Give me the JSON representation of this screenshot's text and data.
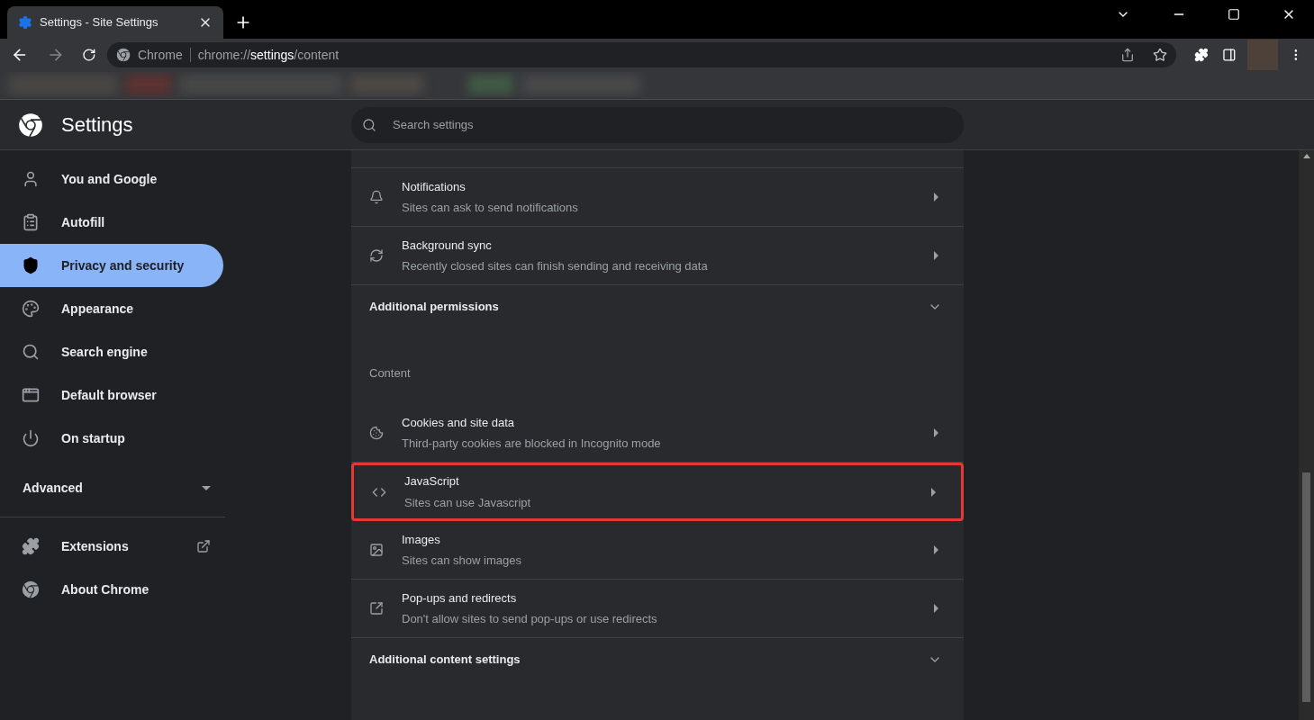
{
  "tab": {
    "title": "Settings - Site Settings",
    "selected": true
  },
  "toolbar": {
    "site_label": "Chrome",
    "url_prefix": "chrome://",
    "url_host": "settings",
    "url_path": "/content"
  },
  "header": {
    "title": "Settings",
    "search_placeholder": "Search settings"
  },
  "sidebar": {
    "items": [
      {
        "label": "You and Google",
        "selected": false
      },
      {
        "label": "Autofill",
        "selected": false
      },
      {
        "label": "Privacy and security",
        "selected": true
      },
      {
        "label": "Appearance",
        "selected": false
      },
      {
        "label": "Search engine",
        "selected": false
      },
      {
        "label": "Default browser",
        "selected": false
      },
      {
        "label": "On startup",
        "selected": false
      }
    ],
    "advanced": {
      "label": "Advanced",
      "expanded": false
    },
    "footer_items": [
      {
        "label": "Extensions"
      },
      {
        "label": "About Chrome"
      }
    ]
  },
  "content": {
    "items": [
      {
        "kind": "row",
        "title": "Notifications",
        "subtitle": "Sites can ask to send notifications",
        "highlighted": false
      },
      {
        "kind": "row",
        "title": "Background sync",
        "subtitle": "Recently closed sites can finish sending and receiving data",
        "highlighted": false
      },
      {
        "kind": "expander",
        "title": "Additional permissions",
        "expanded": false
      },
      {
        "kind": "heading",
        "title": "Content"
      },
      {
        "kind": "row",
        "title": "Cookies and site data",
        "subtitle": "Third-party cookies are blocked in Incognito mode",
        "highlighted": false
      },
      {
        "kind": "row",
        "title": "JavaScript",
        "subtitle": "Sites can use Javascript",
        "highlighted": true
      },
      {
        "kind": "row",
        "title": "Images",
        "subtitle": "Sites can show images",
        "highlighted": false
      },
      {
        "kind": "row",
        "title": "Pop-ups and redirects",
        "subtitle": "Don't allow sites to send pop-ups or use redirects",
        "highlighted": false
      },
      {
        "kind": "expander",
        "title": "Additional content settings",
        "expanded": false
      }
    ]
  }
}
